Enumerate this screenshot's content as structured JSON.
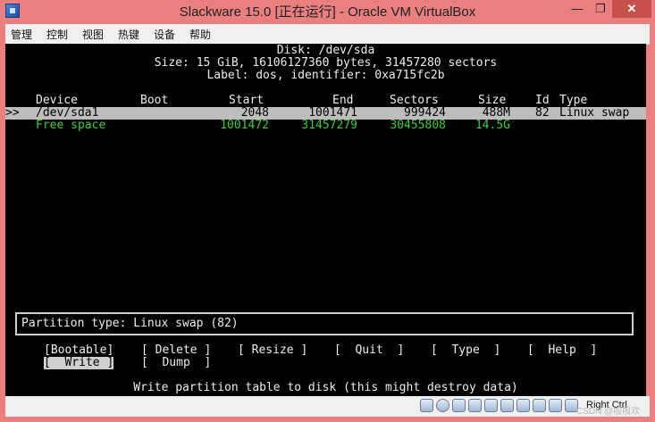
{
  "window": {
    "title": "Slackware 15.0 [正在运行] - Oracle VM VirtualBox",
    "minimize_glyph": "—",
    "maximize_glyph": "❐",
    "close_glyph": "✕"
  },
  "menu": [
    "管理",
    "控制",
    "视图",
    "热键",
    "设备",
    "帮助"
  ],
  "disk": {
    "title": "Disk: /dev/sda",
    "size_line": "Size: 15 GiB, 16106127360 bytes, 31457280 sectors",
    "label_line": "Label: dos, identifier: 0xa715fc2b"
  },
  "table": {
    "headers": [
      "Device",
      "Boot",
      "Start",
      "End",
      "Sectors",
      "Size",
      "Id",
      "Type"
    ],
    "rows": [
      {
        "marker": ">>",
        "device": "/dev/sda1",
        "boot": "",
        "start": "2048",
        "end": "1001471",
        "sectors": "999424",
        "size": "488M",
        "id": "82",
        "type": "Linux swap"
      },
      {
        "marker": "",
        "device": "Free space",
        "boot": "",
        "start": "1001472",
        "end": "31457279",
        "sectors": "30455808",
        "size": "14.5G",
        "id": "",
        "type": ""
      }
    ]
  },
  "partition_type": "Partition type: Linux swap (82)",
  "buttons": [
    "[Bootable]",
    "[ Delete ]",
    "[ Resize ]",
    "[  Quit  ]",
    "[  Type  ]",
    "[  Help  ]",
    "[  Write ]",
    "[  Dump  ]"
  ],
  "status_message": "Write partition table to disk (this might destroy data)",
  "statusbar": {
    "host_key": "Right Ctrl",
    "icons": [
      "hard-disk-icon",
      "optical-drive-icon",
      "audio-icon",
      "network-icon",
      "usb-icon",
      "shared-folder-icon",
      "display-icon",
      "video-capture-icon",
      "cpu-icon",
      "keyboard-icon"
    ],
    "watermark": "CSDN @殷殷欢"
  }
}
